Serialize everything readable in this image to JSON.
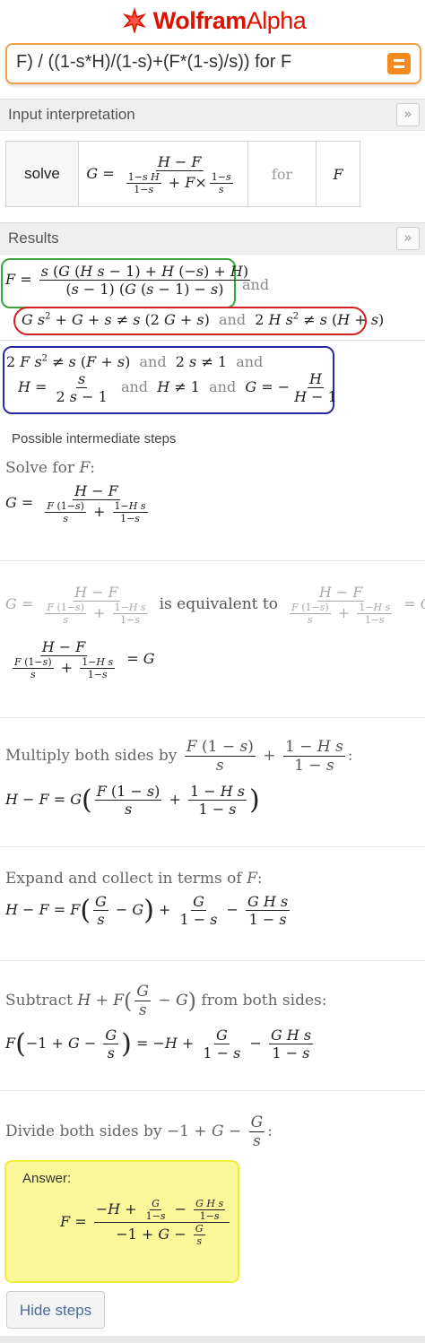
{
  "app": {
    "logo_main": "Wolfram",
    "logo_sub": "Alpha"
  },
  "query": {
    "text": "F) / ((1-s*H)/(1-s)+(F*(1-s)/s)) for F"
  },
  "pods": {
    "input_interpretation": {
      "title": "Input interpretation",
      "solve": "solve",
      "for": "for",
      "var": "F"
    },
    "results": {
      "title": "Results",
      "and": "and"
    }
  },
  "steps": {
    "title": "Possible intermediate steps",
    "solve_for": "Solve for",
    "equivalent": "is equivalent to",
    "multiply": "Multiply both sides by",
    "expand": "Expand and collect in terms of",
    "subtract_from": "Subtract",
    "subtract_end": "from both sides:",
    "divide": "Divide both sides by",
    "answer_label": "Answer:",
    "hide_button": "Hide steps"
  },
  "colors": {
    "box_green": "#3aa63a",
    "box_red": "#d42020",
    "box_blue": "#2a2aa8",
    "answer_bg": "#fbf89c",
    "query_border": "#f4a040",
    "brand": "#dd1100"
  },
  "icons": {
    "logo": "wolfram-star-icon",
    "equals_button": "equals-icon",
    "more": "double-chevron-right-icon"
  }
}
